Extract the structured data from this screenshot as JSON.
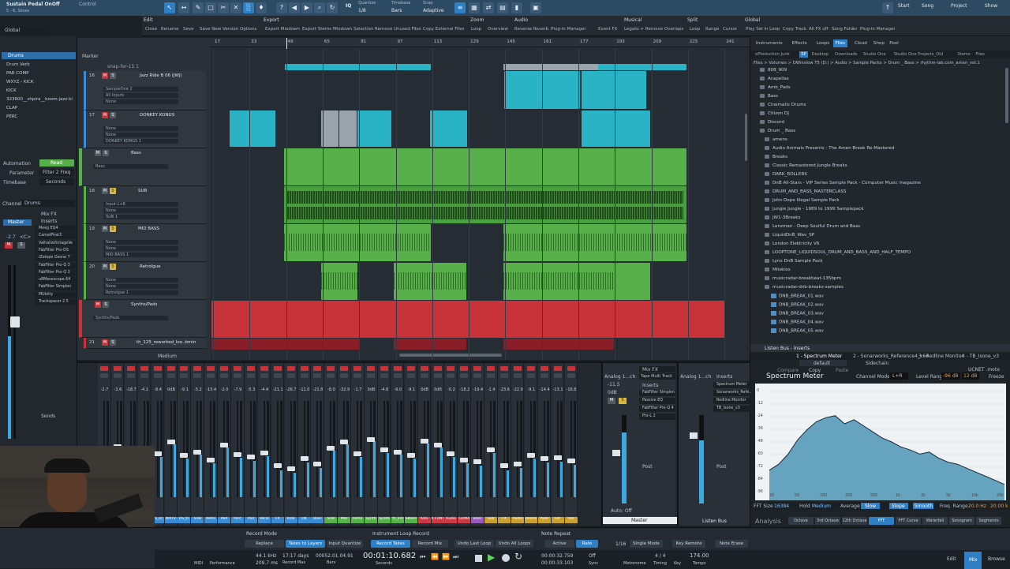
{
  "topbar": {
    "title": "Sustain Pedal OnOff",
    "subtitle": "5 - 6, Slicex",
    "control_label": "Control",
    "quantize_label": "Quantize",
    "quantize_value": "1/8",
    "timebase_label": "Timebase",
    "timebase_value": "Bars",
    "snap_label": "Snap",
    "snap_value": "Adaptive",
    "iq": "IQ",
    "start": "Start",
    "song": "Song",
    "project": "Project",
    "show": "Show"
  },
  "menus": {
    "edit": {
      "label": "Edit",
      "items": [
        "Close",
        "Rename",
        "Save",
        "Save New Version",
        "Options"
      ]
    },
    "export": {
      "label": "Export",
      "items": [
        "Export Mixdown",
        "Export Stems",
        "Mixdown Selection",
        "Remove Unused Files",
        "Copy External Files"
      ]
    },
    "zoom": {
      "label": "Zoom",
      "items": [
        "Loop",
        "Overview"
      ]
    },
    "audio": {
      "label": "Audio",
      "items": [
        "Reverse Reverb",
        "Plug-in Manager",
        "Event FX"
      ]
    },
    "musical": {
      "label": "Musical",
      "items": [
        "Legato + Remove Overlaps"
      ]
    },
    "split": {
      "label": "Split",
      "items": [
        "Loop",
        "Range",
        "Cursor"
      ]
    },
    "global": {
      "label": "Global",
      "items": [
        "Play Sel in Loop",
        "Copy Track",
        "All FX off",
        "Song Folder",
        "Plug-in Manager"
      ]
    }
  },
  "inspector": {
    "preset": "Global",
    "folder": "Drums",
    "items": [
      "Drum Verb",
      "PAR COMP",
      "WXYZ - KICK",
      "KICK",
      "323600__shpira__boom-jazz-ki",
      "CLAP",
      "PERC"
    ],
    "automation_label": "Automation",
    "automation_value": "Read",
    "parameter_label": "Parameter",
    "parameter_value": "Filter 2 Freq",
    "timebase_label": "Timebase",
    "timebase_value": "Seconds",
    "channel_label": "Channel",
    "channel_value": "Drums",
    "mixfx": "Mix FX",
    "inserts_label": "Inserts",
    "inserts": [
      "Meeg EQ4",
      "CamelPhat3",
      "ValhallaVintageVe",
      "FabFilter Pro-DS",
      "iZotope Ozone 7",
      "FabFilter Pro-Q 3",
      "FabFilter Pro-Q 3",
      "u8Mesoscope.64",
      "FabFilter Simplon",
      "MUbiity",
      "Trackspacer 2.5"
    ],
    "sends_label": "Sends",
    "master_label": "Master",
    "vol": "-2.7",
    "pan": "<C>"
  },
  "marker_label": "Marker",
  "ruler": [
    "17",
    "33",
    "49",
    "65",
    "81",
    "97",
    "113",
    "129",
    "145",
    "161",
    "177",
    "193",
    "209",
    "225",
    "241"
  ],
  "tracks": [
    {
      "num": "16",
      "name": "Jazz Ride B 06 (JWJ)",
      "sub": [
        "SampleOne 2",
        "All Inputs",
        "None"
      ]
    },
    {
      "num": "17",
      "name": "DONKEY KONGS",
      "sub": [
        "None",
        "None",
        "DONKEY KONGS 1"
      ]
    },
    {
      "num": "",
      "name": "Bass",
      "sub": [
        "Bass"
      ]
    },
    {
      "num": "18",
      "name": "SUB",
      "sub": [
        "Input L+R",
        "None",
        "SUB 1"
      ]
    },
    {
      "num": "19",
      "name": "MID BASS",
      "sub": [
        "None",
        "None",
        "MID BASS 1"
      ]
    },
    {
      "num": "20",
      "name": "Retrolgue",
      "sub": [
        "None",
        "None",
        "Retrolgue 1"
      ]
    },
    {
      "num": "",
      "name": "Synths/Pads",
      "sub": [
        "Synths/Pads"
      ]
    },
    {
      "num": "21",
      "name": "th_125_reworked_loo..bmin",
      "sub": []
    }
  ],
  "arrange_clip_label": "snap-fer-15 1",
  "browser": {
    "tabs": [
      "Instruments",
      "Effects",
      "Loops",
      "Files",
      "Cloud",
      "Shop",
      "Pool"
    ],
    "locations": [
      "ePtoduction Junk",
      "SP",
      "Desktop",
      "Downloads",
      "Studio One",
      "Studio One Projects_Old",
      "Stems",
      "Files"
    ],
    "path": "Files > Volumes > DWinslow T5 (D:) > Audio > Sample Packs > Drum _ Bass > rhythm-lab.com_amen_vol.1",
    "folders": [
      "808_909",
      "Acapellas",
      "Amb_Pads",
      "Bass",
      "Cinematic Drums",
      "Citizen DJ",
      "Discord",
      "Drum _ Bass",
      "amens",
      "Audio Animals Presents - The Amen Break Re-Mastered",
      "Breaks",
      "Classic Remastered Jungle Breaks",
      "DARK_ROLLERS",
      "DnB All-Stars - VIP Series Sample Pack - Computer Music magazine",
      "DRUM_AND_BASS_MASTERCLASS",
      "John Dope Illegal Sample Pack",
      "Jungle Jungle - 1989 to 1999 Samplepack",
      "JW1-3Breaks",
      "Lenzman - Deep Soulful Drum and Bass",
      "LiquidDnB_Wav_SP",
      "London Elektricity V6",
      "LOOPTONE_LIQUIDSOUL_DRUM_AND_BASS_AND_HALF_TEMPO",
      "Lynx DnB Sample Pack",
      "Mitekiss",
      "musicradar-breakbeat-135bpm",
      "musicradar-dnb-breaks-samples"
    ],
    "files": [
      "DNB_BREAK_01.wav",
      "DNB_BREAK_02.wav",
      "DNB_BREAK_03.wav",
      "DNB_BREAK_04.wav",
      "DNB_BREAK_05.wav"
    ]
  },
  "inserts_panel": {
    "title": "Listen Bus - Inserts",
    "slot": "1 - Spectrum Meter",
    "slot2": "2 - Sonarworks_Reference4_x64",
    "slot3": "3 - Redline Monitor",
    "slot4": "4 - TB_Isone_v3",
    "preset": "default",
    "sidechain": "Sidechain",
    "compare": "Compare",
    "copy": "Copy",
    "paste": "Paste",
    "vendor": "UCNET .mote"
  },
  "spectrum": {
    "title": "Spectrum Meter",
    "channel_mode_label": "Channel Mode",
    "channel_mode": "L+R",
    "level_range_label": "Level Range",
    "level_min": "-96 dB",
    "level_max": "12 dB",
    "freeze": "Freeze",
    "db_labels": [
      "0",
      "-12",
      "-24",
      "-36",
      "-48",
      "-60",
      "-72",
      "-84",
      "-96"
    ],
    "freq_labels": [
      "20",
      "50",
      "100",
      "200",
      "500",
      "1k",
      "2k",
      "5k",
      "10k",
      "20k"
    ],
    "fft_size_label": "FFT Size",
    "fft_size": "16384",
    "hold_label": "Hold",
    "hold": "Medium",
    "average_label": "Average",
    "average": "Slow",
    "slope": "Slope",
    "smooth": "Smooth",
    "freq_range_label": "Freq. Range",
    "freq_min": "20.0 Hz",
    "freq_max": "20.00 k",
    "analysis": "Analysis",
    "modes": [
      "Octave",
      "3rd Octave",
      "12th Octave",
      "FFT",
      "FFT Curve",
      "Waterfall",
      "Sonogram",
      "Segments"
    ],
    "curve": [
      0.78,
      0.72,
      0.62,
      0.48,
      0.38,
      0.3,
      0.26,
      0.24,
      0.32,
      0.28,
      0.34,
      0.4,
      0.46,
      0.5,
      0.55,
      0.58,
      0.62,
      0.6,
      0.66,
      0.7,
      0.72,
      0.76,
      0.8,
      0.84,
      0.88,
      0.92
    ]
  },
  "console": {
    "strip_vols": [
      "-2.7",
      "-3.6",
      "-18.7",
      "-4.1",
      "-8.4",
      "0dB",
      "-9.1",
      "-5.2",
      "-15.4",
      "-2.0",
      "-7.9",
      "-5.3",
      "-4.4",
      "-21.1",
      "-26.7",
      "-11.0",
      "-21.8",
      "-8.0",
      "-32.9",
      "-1.7",
      "0dB",
      "-4.6",
      "-6.0",
      "-9.1",
      "0dB",
      "0dB",
      "-0.2",
      "-18.2",
      "-19.4",
      "-1.4",
      "-23.6",
      "-22.9",
      "-9.1",
      "-14.4",
      "-13.1",
      "-16.8"
    ],
    "strip_names": [
      "KICK",
      "323600",
      "CLAP",
      "OS_sc",
      "TS_sc",
      "WXYZ",
      "DS_tn",
      "SUB",
      "Retro",
      "Mid",
      "Perc",
      "Pad",
      "Vocal",
      "FX",
      "Ride",
      "DK",
      "Bass",
      "SUB",
      "MID",
      "Retro",
      "Synth",
      "SynPa",
      "th_nm",
      "SBVen",
      "Koto",
      "K.FUNT",
      "Audio",
      "GUMA",
      "Bass",
      "Sub",
      "FX",
      "Audio",
      "Drums",
      "Pads",
      "Gtr",
      "Out"
    ],
    "strip_colors": [
      "#3a8bd1",
      "#3a8bd1",
      "#3a8bd1",
      "#3a8bd1",
      "#3a8bd1",
      "#3a8bd1",
      "#3a8bd1",
      "#3a8bd1",
      "#3a8bd1",
      "#3a8bd1",
      "#3a8bd1",
      "#3a8bd1",
      "#3a8bd1",
      "#3a8bd1",
      "#3a8bd1",
      "#3a8bd1",
      "#3a8bd1",
      "#58b04a",
      "#58b04a",
      "#58b04a",
      "#58b04a",
      "#58b04a",
      "#58b04a",
      "#58b04a",
      "#c83a44",
      "#c83a44",
      "#c83a44",
      "#c83a44",
      "#9a5ab8",
      "#c8a030",
      "#c8a030",
      "#c8a030",
      "#c8a030",
      "#c8a030",
      "#c8a030",
      "#c8a030"
    ],
    "strip_levels": [
      0.45,
      0.5,
      0.3,
      0.46,
      0.42,
      0.55,
      0.4,
      0.44,
      0.35,
      0.52,
      0.41,
      0.38,
      0.43,
      0.28,
      0.25,
      0.36,
      0.3,
      0.48,
      0.55,
      0.42,
      0.58,
      0.46,
      0.44,
      0.4,
      0.56,
      0.52,
      0.42,
      0.35,
      0.33,
      0.46,
      0.28,
      0.3,
      0.4,
      0.36,
      0.37,
      0.34
    ],
    "medium": "Medium",
    "analog_a": "Analog 1...ch",
    "analog_b": "Analog 1...ch",
    "mix_fx": "Mix FX",
    "tape_multi": "Tape Multi Track",
    "inserts": "Inserts",
    "master_inserts": [
      "FabFilter Simplon",
      "Passive EQ",
      "FabFilter Pro-Q 4",
      "Pro-L 2"
    ],
    "listen_inserts": [
      "Spectrum Meter",
      "Sonarworks_Refe..",
      "Redline Monitor",
      "TB_Isone_v3"
    ],
    "post": "Post",
    "master_name": "Master",
    "listen_name": "Listen Bus",
    "auto_off": "Auto: Off",
    "master_vol": "0dB",
    "master_vol2": "-11.5"
  },
  "transport": {
    "record_mode": "Record Mode",
    "replace": "Replace",
    "takes_to_layers": "Takes to Layers",
    "input_quantize": "Input Quantize",
    "loop_record": "Instrument Loop Record",
    "record_takes": "Record Takes",
    "record_mix": "Record Mix",
    "undo_last": "Undo Last Loop",
    "undo_all": "Undo All Loops",
    "note_repeat": "Note Repeat",
    "active": "Active",
    "rate": "Rate",
    "rate_value": "1/16",
    "single_mode": "Single Mode",
    "key_remote": "Key Remote",
    "note_erase": "Note Erase",
    "midi": "MIDI",
    "performance": "Performance",
    "sample_rate": "44.1 kHz",
    "latency": "209.7 ms",
    "record_time": "17:17 days",
    "record_max": "Record Max",
    "bars_pos": "00052.01.04.91",
    "bars": "Bars",
    "time_pos": "00:01:10.682",
    "seconds": "Seconds",
    "loop_start": "00:00:32.759",
    "loop_end": "00:00:33.103",
    "off": "Off",
    "sync": "Sync",
    "metronome": "Metronome",
    "timing": "Timing",
    "signature": "4 / 4",
    "key": "Key",
    "tempo": "174.00",
    "tempo_label": "Tempo",
    "edit": "Edit",
    "mix": "Mix",
    "browse": "Browse"
  }
}
